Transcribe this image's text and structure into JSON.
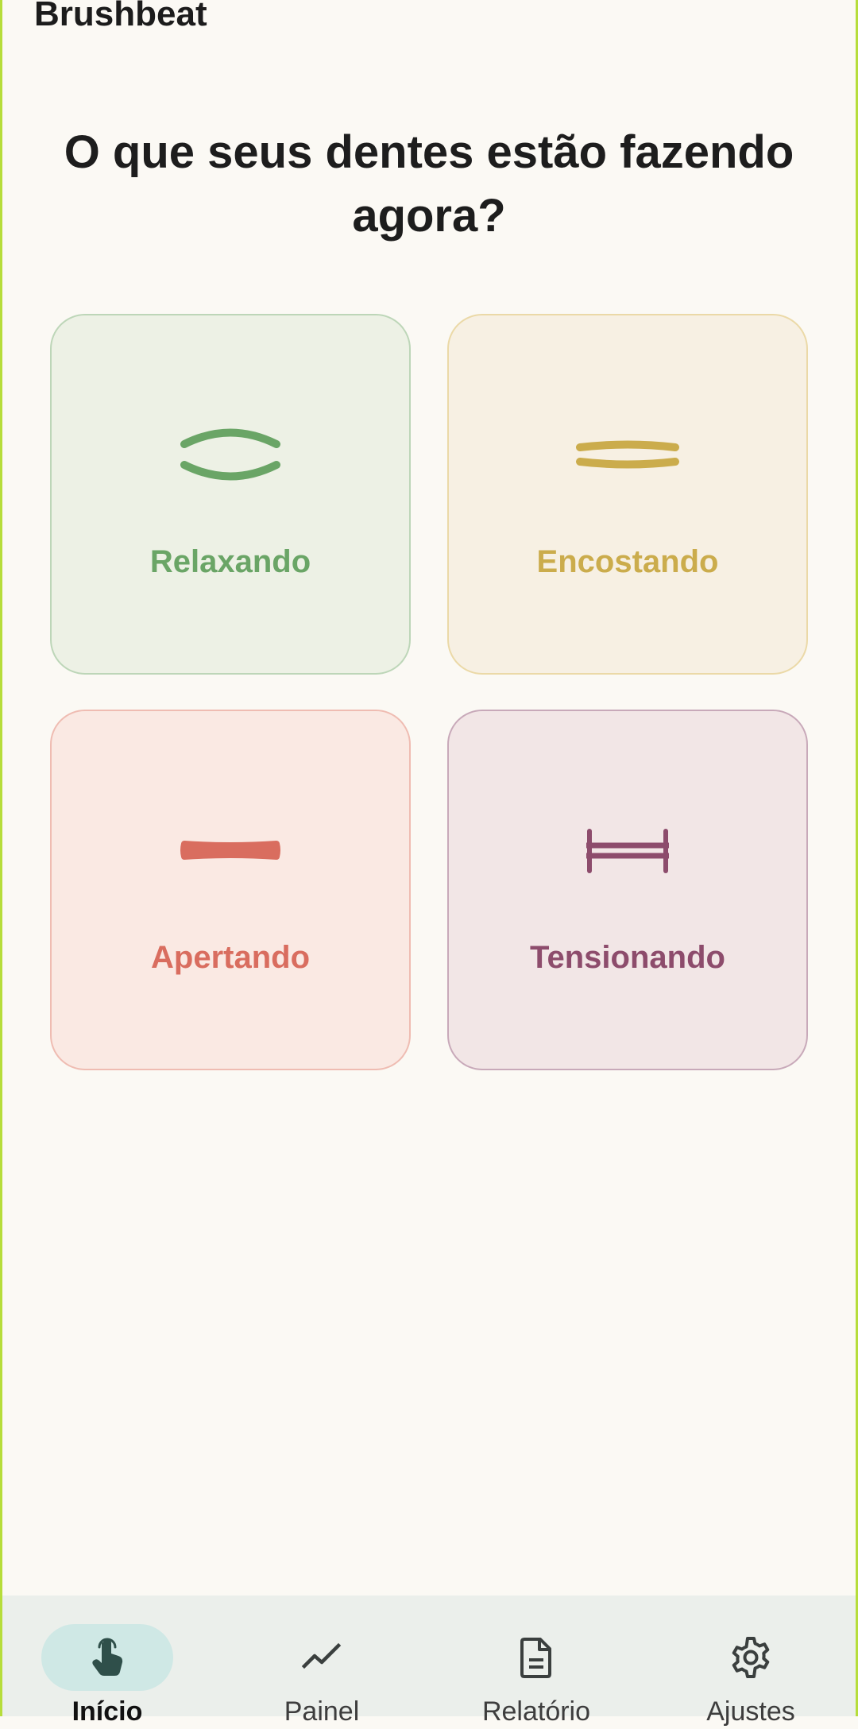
{
  "app": {
    "title": "Brushbeat"
  },
  "main": {
    "question": "O que seus dentes estão fazendo agora?",
    "options": [
      {
        "label": "Relaxando",
        "icon": "relaxed-teeth-icon",
        "color": "#6aa566"
      },
      {
        "label": "Encostando",
        "icon": "touching-teeth-icon",
        "color": "#cbac4c"
      },
      {
        "label": "Apertando",
        "icon": "clenching-teeth-icon",
        "color": "#d96d5f"
      },
      {
        "label": "Tensionando",
        "icon": "tensing-teeth-icon",
        "color": "#8d4c6c"
      }
    ]
  },
  "bottom_nav": {
    "items": [
      {
        "label": "Início",
        "icon": "touch-hand-icon",
        "active": true
      },
      {
        "label": "Painel",
        "icon": "trend-line-icon",
        "active": false
      },
      {
        "label": "Relatório",
        "icon": "document-icon",
        "active": false
      },
      {
        "label": "Ajustes",
        "icon": "gear-icon",
        "active": false
      }
    ]
  }
}
